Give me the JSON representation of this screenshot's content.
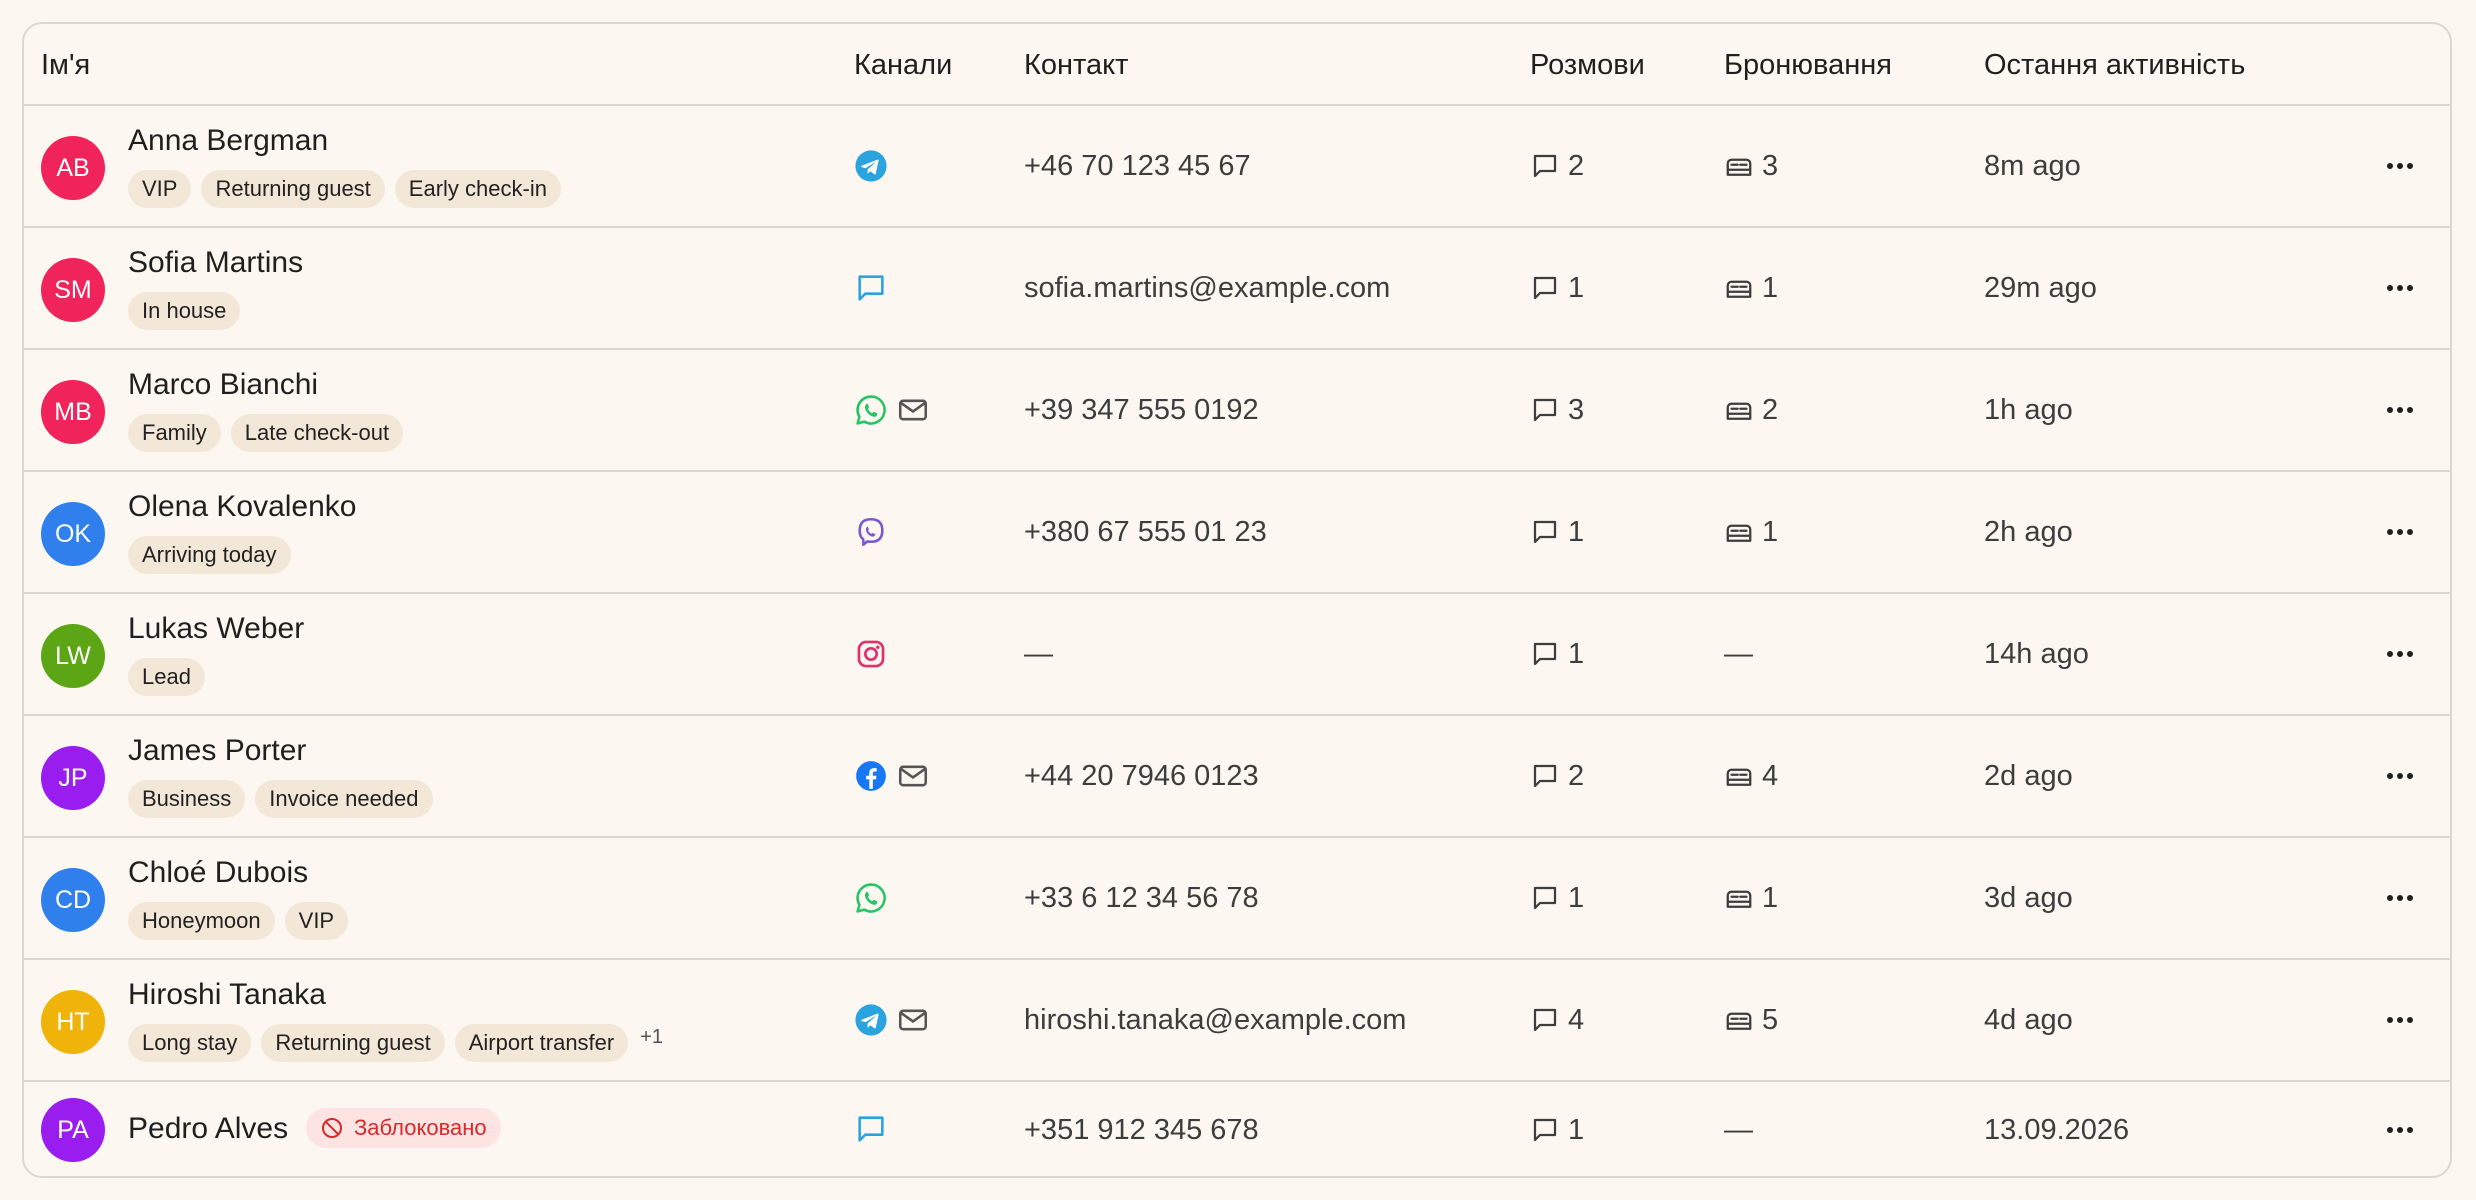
{
  "headers": {
    "name": "Ім'я",
    "channels": "Канали",
    "contact": "Контакт",
    "conversations": "Розмови",
    "bookings": "Бронювання",
    "activity": "Остання активність"
  },
  "colors": {
    "avatar_pink": "#f0245a",
    "avatar_blue": "#2f80ed",
    "avatar_green": "#5ca616",
    "avatar_purple": "#9a1df0",
    "avatar_amber": "#f0b30a",
    "tag_bg": "#f3e8d8",
    "blocked_bg": "#fde3e1",
    "blocked_text": "#d72a2a"
  },
  "rows": [
    {
      "initials": "AB",
      "name": "Anna Bergman",
      "tags": [
        "VIP",
        "Returning guest",
        "Early check-in"
      ],
      "channels": [
        "telegram-icon"
      ],
      "contact": "+46 70 123 45 67",
      "conversations": "2",
      "bookings": "3",
      "activity": "8m ago"
    },
    {
      "initials": "SM",
      "name": "Sofia Martins",
      "tags": [
        "In house"
      ],
      "channels": [
        "chat-icon"
      ],
      "contact": "sofia.martins@example.com",
      "conversations": "1",
      "bookings": "1",
      "activity": "29m ago"
    },
    {
      "initials": "MB",
      "name": "Marco Bianchi",
      "tags": [
        "Family",
        "Late check-out"
      ],
      "channels": [
        "whatsapp-icon",
        "mail-icon"
      ],
      "contact": "+39 347 555 0192",
      "conversations": "3",
      "bookings": "2",
      "activity": "1h ago"
    },
    {
      "initials": "OK",
      "name": "Olena Kovalenko",
      "tags": [
        "Arriving today"
      ],
      "channels": [
        "viber-icon"
      ],
      "contact": "+380 67 555 01 23",
      "conversations": "1",
      "bookings": "1",
      "activity": "2h ago"
    },
    {
      "initials": "LW",
      "name": "Lukas Weber",
      "tags": [
        "Lead"
      ],
      "channels": [
        "instagram-icon"
      ],
      "contact": "—",
      "conversations": "1",
      "bookings": "—",
      "activity": "14h ago"
    },
    {
      "initials": "JP",
      "name": "James Porter",
      "tags": [
        "Business",
        "Invoice needed"
      ],
      "channels": [
        "facebook-icon",
        "mail-icon"
      ],
      "contact": "+44 20 7946 0123",
      "conversations": "2",
      "bookings": "4",
      "activity": "2d ago"
    },
    {
      "initials": "CD",
      "name": "Chloé Dubois",
      "tags": [
        "Honeymoon",
        "VIP"
      ],
      "channels": [
        "whatsapp-icon"
      ],
      "contact": "+33 6 12 34 56 78",
      "conversations": "1",
      "bookings": "1",
      "activity": "3d ago"
    },
    {
      "initials": "HT",
      "name": "Hiroshi Tanaka",
      "tags": [
        "Long stay",
        "Returning guest",
        "Airport transfer"
      ],
      "extra_tags": "+1",
      "channels": [
        "telegram-icon",
        "mail-icon"
      ],
      "contact": "hiroshi.tanaka@example.com",
      "conversations": "4",
      "bookings": "5",
      "activity": "4d ago"
    },
    {
      "initials": "PA",
      "name": "Pedro Alves",
      "blocked_label": "Заблоковано",
      "channels": [
        "chat-icon"
      ],
      "contact": "+351 912 345 678",
      "conversations": "1",
      "bookings": "—",
      "activity": "13.09.2026"
    }
  ]
}
